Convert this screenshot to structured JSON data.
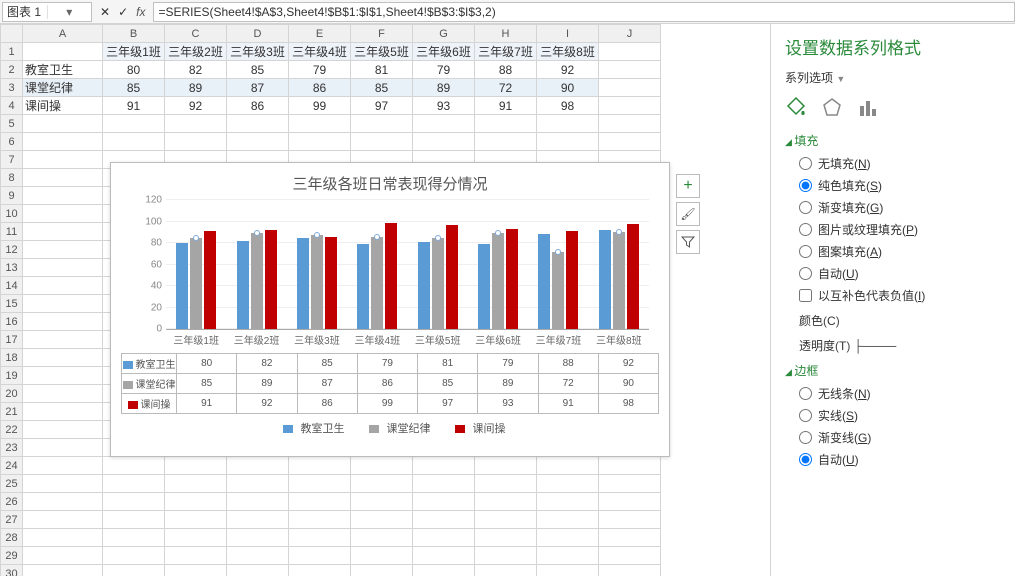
{
  "name_box": "图表 1",
  "formula": "=SERIES(Sheet4!$A$3,Sheet4!$B$1:$I$1,Sheet4!$B$3:$I$3,2)",
  "columns": [
    "A",
    "B",
    "C",
    "D",
    "E",
    "F",
    "G",
    "H",
    "I",
    "J"
  ],
  "row_labels": [
    "教室卫生",
    "课堂纪律",
    "课间操"
  ],
  "class_headers": [
    "三年级1班",
    "三年级2班",
    "三年级3班",
    "三年级4班",
    "三年级5班",
    "三年级6班",
    "三年级7班",
    "三年级8班"
  ],
  "grid_values": [
    [
      80,
      82,
      85,
      79,
      81,
      79,
      88,
      92
    ],
    [
      85,
      89,
      87,
      86,
      85,
      89,
      72,
      90
    ],
    [
      91,
      92,
      86,
      99,
      97,
      93,
      91,
      98
    ]
  ],
  "chart_data": {
    "type": "bar",
    "title": "三年级各班日常表现得分情况",
    "categories": [
      "三年级1班",
      "三年级2班",
      "三年级3班",
      "三年级4班",
      "三年级5班",
      "三年级6班",
      "三年级7班",
      "三年级8班"
    ],
    "series": [
      {
        "name": "教室卫生",
        "color": "#5b9bd5",
        "values": [
          80,
          82,
          85,
          79,
          81,
          79,
          88,
          92
        ]
      },
      {
        "name": "课堂纪律",
        "color": "#a5a5a5",
        "values": [
          85,
          89,
          87,
          86,
          85,
          89,
          72,
          90
        ]
      },
      {
        "name": "课间操",
        "color": "#c00000",
        "values": [
          91,
          92,
          86,
          99,
          97,
          93,
          91,
          98
        ]
      }
    ],
    "yticks": [
      0,
      20,
      40,
      60,
      80,
      100,
      120
    ],
    "ylim": [
      0,
      120
    ]
  },
  "side_buttons": {
    "add": "+",
    "brush": "🖌",
    "filter": "▼"
  },
  "pane": {
    "title": "设置数据系列格式",
    "sub": "系列选项",
    "fill_head": "填充",
    "fill_opts": [
      {
        "label": "无填充",
        "key": "N",
        "sel": false
      },
      {
        "label": "纯色填充",
        "key": "S",
        "sel": true
      },
      {
        "label": "渐变填充",
        "key": "G",
        "sel": false
      },
      {
        "label": "图片或纹理填充",
        "key": "P",
        "sel": false
      },
      {
        "label": "图案填充",
        "key": "A",
        "sel": false
      },
      {
        "label": "自动",
        "key": "U",
        "sel": false
      }
    ],
    "invert": {
      "label": "以互补色代表负值",
      "key": "I"
    },
    "color": {
      "label": "颜色",
      "key": "C"
    },
    "transparency": {
      "label": "透明度",
      "key": "T"
    },
    "border_head": "边框",
    "border_opts": [
      {
        "label": "无线条",
        "key": "N",
        "sel": false
      },
      {
        "label": "实线",
        "key": "S",
        "sel": false
      },
      {
        "label": "渐变线",
        "key": "G",
        "sel": false
      },
      {
        "label": "自动",
        "key": "U",
        "sel": true
      }
    ]
  }
}
